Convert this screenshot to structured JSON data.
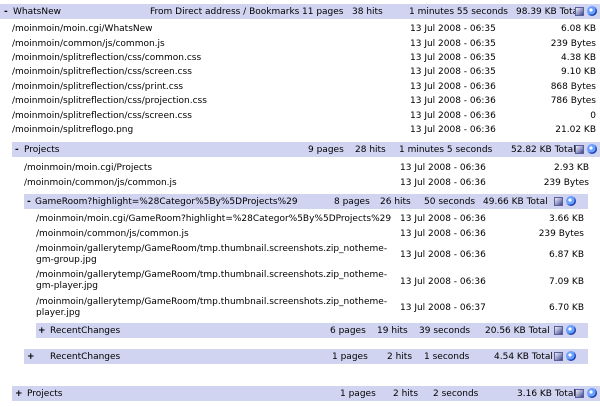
{
  "sections": [
    {
      "toggle": "-",
      "name": "WhatsNew",
      "from": "From Direct address / Bookmarks",
      "pages": "11 pages",
      "hits": "38 hits",
      "time": "1 minutes 55 seconds",
      "size": "98.39 KB Total"
    },
    {
      "toggle": "-",
      "name": "Projects",
      "pages": "9 pages",
      "hits": "28 hits",
      "time": "1 minutes 5 seconds",
      "size": "52.82 KB Total"
    },
    {
      "toggle": "-",
      "name": "GameRoom?highlight=%28Categor%5By%5DProjects%29",
      "pages": "8 pages",
      "hits": "26 hits",
      "time": "50 seconds",
      "size": "49.66 KB Total"
    },
    {
      "toggle": "+",
      "name": "RecentChanges",
      "pages": "6 pages",
      "hits": "19 hits",
      "time": "39 seconds",
      "size": "20.56 KB Total"
    },
    {
      "toggle": "+",
      "name": "RecentChanges",
      "pages": "1 pages",
      "hits": "2 hits",
      "time": "1 seconds",
      "size": "4.54 KB Total"
    },
    {
      "toggle": "+",
      "name": "Projects",
      "pages": "1 pages",
      "hits": "2 hits",
      "time": "2 seconds",
      "size": "3.16 KB Total"
    }
  ],
  "rows_whatsnew": [
    {
      "path": "/moinmoin/moin.cgi/WhatsNew",
      "date": "13 Jul 2008 - 06:35",
      "size": "6.08 KB"
    },
    {
      "path": "/moinmoin/common/js/common.js",
      "date": "13 Jul 2008 - 06:35",
      "size": "239 Bytes"
    },
    {
      "path": "/moinmoin/splitreflection/css/common.css",
      "date": "13 Jul 2008 - 06:35",
      "size": "4.38 KB"
    },
    {
      "path": "/moinmoin/splitreflection/css/screen.css",
      "date": "13 Jul 2008 - 06:35",
      "size": "9.10 KB"
    },
    {
      "path": "/moinmoin/splitreflection/css/print.css",
      "date": "13 Jul 2008 - 06:36",
      "size": "868 Bytes"
    },
    {
      "path": "/moinmoin/splitreflection/css/projection.css",
      "date": "13 Jul 2008 - 06:36",
      "size": "786 Bytes"
    },
    {
      "path": "/moinmoin/splitreflection/css/screen.css",
      "date": "13 Jul 2008 - 06:36",
      "size": "0"
    },
    {
      "path": "/moinmoin/splitreflogo.png",
      "date": "13 Jul 2008 - 06:36",
      "size": "21.02 KB"
    }
  ],
  "rows_projects": [
    {
      "path": "/moinmoin/moin.cgi/Projects",
      "date": "13 Jul 2008 - 06:36",
      "size": "2.93 KB"
    },
    {
      "path": "/moinmoin/common/js/common.js",
      "date": "13 Jul 2008 - 06:36",
      "size": "239 Bytes"
    }
  ],
  "rows_gameroom": [
    {
      "path": "/moinmoin/moin.cgi/GameRoom?highlight=%28Categor%5By%5DProjects%29",
      "date": "13 Jul 2008 - 06:36",
      "size": "3.66 KB"
    },
    {
      "path": "/moinmoin/common/js/common.js",
      "date": "13 Jul 2008 - 06:36",
      "size": "239 Bytes"
    },
    {
      "path1": "/moinmoin/gallerytemp/GameRoom/tmp.thumbnail.screenshots.zip_notheme-",
      "path2": "gm-group.jpg",
      "date": "13 Jul 2008 - 06:36",
      "size": "6.87 KB"
    },
    {
      "path1": "/moinmoin/gallerytemp/GameRoom/tmp.thumbnail.screenshots.zip_notheme-",
      "path2": "gm-player.jpg",
      "date": "13 Jul 2008 - 06:36",
      "size": "7.09 KB"
    },
    {
      "path1": "/moinmoin/gallerytemp/GameRoom/tmp.thumbnail.screenshots.zip_notheme-",
      "path2": "player.jpg",
      "date": "13 Jul 2008 - 06:37",
      "size": "6.70 KB"
    }
  ]
}
